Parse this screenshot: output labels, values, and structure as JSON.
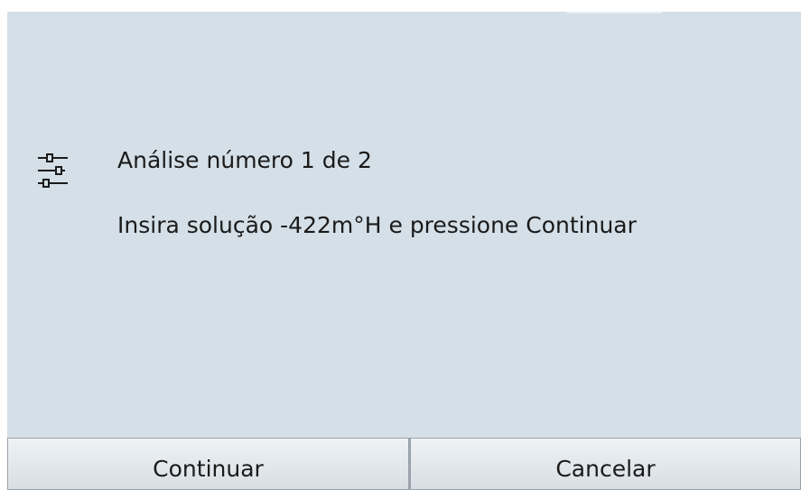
{
  "dialog": {
    "icon": "sliders-icon",
    "title": "Análise número 1 de 2",
    "message": "Insira solução -422m°H e pressione Continuar"
  },
  "buttons": {
    "continue_label": "Continuar",
    "cancel_label": "Cancelar"
  },
  "colors": {
    "background": "#d4dfe7",
    "button_face": "#e3e8ec",
    "text": "#1a1a1a"
  }
}
